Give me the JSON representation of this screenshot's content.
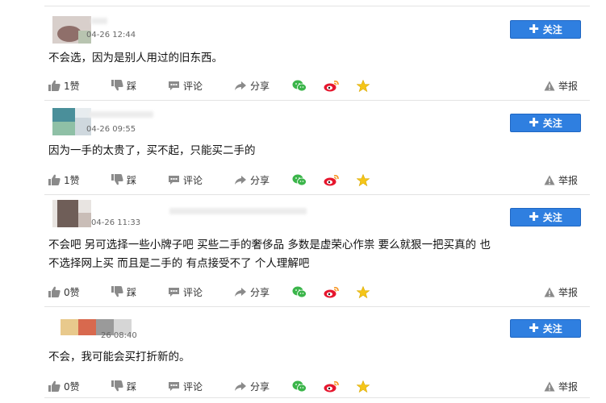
{
  "colors": {
    "follow_bg": "#2f7fe0",
    "icon_gray": "#8a8a8a",
    "wechat_green": "#3bb54a",
    "weibo_red": "#e6162d",
    "star_yellow": "#f5c518"
  },
  "icons": {
    "like": "thumb-up-icon",
    "dislike": "thumb-down-icon",
    "comment": "chat-bubble-icon",
    "share": "share-arrow-icon",
    "wechat": "wechat-icon",
    "weibo": "weibo-icon",
    "favorite": "star-icon",
    "report": "warning-triangle-icon"
  },
  "labels": {
    "follow": "关注",
    "dislike": "踩",
    "comment": "评论",
    "share": "分享",
    "report": "举报"
  },
  "comments": [
    {
      "time": "04-26 12:44",
      "text": "不会选，因为是别人用过的旧东西。",
      "likes": "1赞"
    },
    {
      "time": "04-26 09:55",
      "text": "因为一手的太贵了，买不起，只能买二手的",
      "likes": "1赞"
    },
    {
      "time": "04-26 11:33",
      "text_line1": "不会吧 另可选择一些小牌子吧 买些二手的奢侈品 多数是虚荣心作祟 要么就狠一把买真的 也",
      "text_line2": "不选择网上买 而且是二手的 有点接受不了 个人理解吧",
      "likes": "0赞"
    },
    {
      "time": "26 08:40",
      "text": "不会，我可能会买打折新的。",
      "likes": "0赞"
    }
  ]
}
